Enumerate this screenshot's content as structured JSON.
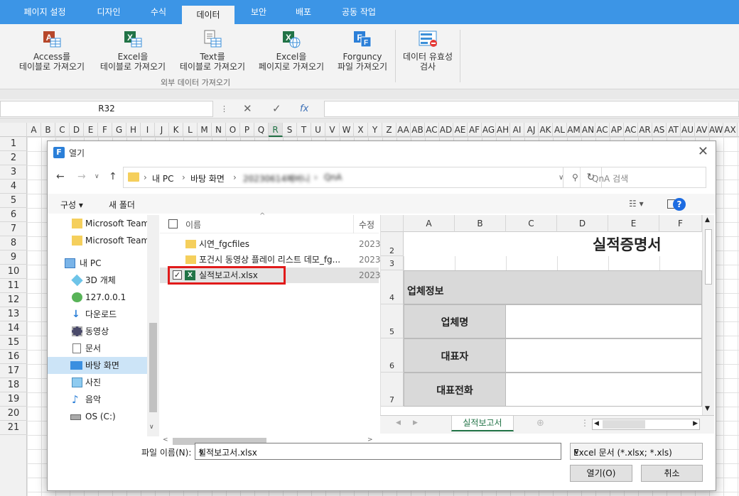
{
  "ribbon": {
    "tabs": [
      "페이지 설정",
      "디자인",
      "수식",
      "데이터",
      "보안",
      "배포",
      "공동 작업"
    ],
    "active_tab": "데이터",
    "buttons": [
      {
        "l1": "Access를",
        "l2": "테이블로 가져오기"
      },
      {
        "l1": "Excel을",
        "l2": "테이블로 가져오기"
      },
      {
        "l1": "Text를",
        "l2": "테이블로 가져오기"
      },
      {
        "l1": "Excel을",
        "l2": "페이지로 가져오기"
      },
      {
        "l1": "Forguncy",
        "l2": "파일 가져오기"
      },
      {
        "l1": "데이터 유효성",
        "l2": "검사"
      }
    ],
    "group_label": "외부 데이터 가져오기"
  },
  "formula_bar": {
    "name_box": "R32",
    "fx": "fx"
  },
  "grid": {
    "columns": [
      "A",
      "B",
      "C",
      "D",
      "E",
      "F",
      "G",
      "H",
      "I",
      "J",
      "K",
      "L",
      "M",
      "N",
      "O",
      "P",
      "Q",
      "R",
      "S",
      "T",
      "U",
      "V",
      "W",
      "X",
      "Y",
      "Z",
      "AA",
      "AB",
      "AC",
      "AD",
      "AE",
      "AF",
      "AG",
      "AH",
      "AI",
      "AJ",
      "AK",
      "AL",
      "AM",
      "AN",
      "AC",
      "AP",
      "AC",
      "AR",
      "AS",
      "AT",
      "AU",
      "AV",
      "AW",
      "AX"
    ],
    "selected_column": "R",
    "rows": [
      "1",
      "2",
      "3",
      "4",
      "5",
      "6",
      "7",
      "8",
      "9",
      "10",
      "11",
      "12",
      "13",
      "14",
      "15",
      "16",
      "17",
      "18",
      "19",
      "20",
      "21"
    ]
  },
  "dialog": {
    "title": "열기",
    "path": [
      "내 PC",
      "바탕 화면",
      "20230614폐버니",
      "QnA"
    ],
    "search_placeholder": "QnA 검색",
    "organize": "구성 ▾",
    "new_folder": "새 폴더",
    "nav_items": [
      {
        "label": "Microsoft Teams",
        "icon": "folder-icon"
      },
      {
        "label": "Microsoft Teams",
        "icon": "folder-icon"
      },
      {
        "label": "내 PC",
        "icon": "pc-icon"
      },
      {
        "label": "3D 개체",
        "icon": "cube-icon"
      },
      {
        "label": "127.0.0.1",
        "icon": "network-drive-icon"
      },
      {
        "label": "다운로드",
        "icon": "download-icon"
      },
      {
        "label": "동영상",
        "icon": "video-icon"
      },
      {
        "label": "문서",
        "icon": "document-icon"
      },
      {
        "label": "바탕 화면",
        "icon": "desktop-icon"
      },
      {
        "label": "사진",
        "icon": "picture-icon"
      },
      {
        "label": "음악",
        "icon": "music-icon"
      },
      {
        "label": "OS (C:)",
        "icon": "drive-icon"
      }
    ],
    "file_header": {
      "name": "이름",
      "modified": "수정"
    },
    "files": [
      {
        "name": "시연_fgcfiles",
        "date": "2023",
        "type": "folder"
      },
      {
        "name": "포건시 동영상 플레이 리스트 데모_fg...",
        "date": "2023",
        "type": "folder"
      },
      {
        "name": "실적보고서.xlsx",
        "date": "2023",
        "type": "excel"
      }
    ],
    "preview": {
      "columns": [
        "A",
        "B",
        "C",
        "D",
        "E",
        "F"
      ],
      "rows": [
        "2",
        "3",
        "4",
        "5",
        "6",
        "7"
      ],
      "title": "실적증명서",
      "section": "업체정보",
      "labels": [
        "업체명",
        "대표자",
        "대표전화"
      ],
      "sheet_tab": "실적보고서"
    },
    "filename_label": "파일 이름(N):",
    "filename_value": "실적보고서.xlsx",
    "filetype": "Excel 문서 (*.xlsx; *.xls)",
    "open_btn": "열기(O)",
    "cancel_btn": "취소"
  }
}
